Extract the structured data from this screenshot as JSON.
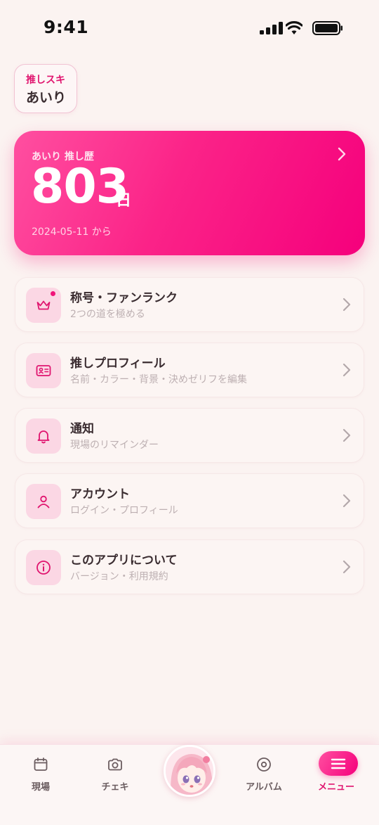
{
  "status_bar": {
    "time": "9:41"
  },
  "oshi_selector": {
    "label": "推しスキ",
    "name": "あいり"
  },
  "hero": {
    "label": "あいり 推し歴",
    "days": "803",
    "unit": "日",
    "since": "2024-05-11 から",
    "accent_start": "#ff4fa0",
    "accent_end": "#f5007c"
  },
  "menu": {
    "items": [
      {
        "title": "称号・ファンランク",
        "subtitle": "2つの道を極める",
        "icon": "crown-icon",
        "has_badge": true
      },
      {
        "title": "推しプロフィール",
        "subtitle": "名前・カラー・背景・決めゼリフを編集",
        "icon": "id-card-icon"
      },
      {
        "title": "通知",
        "subtitle": "現場のリマインダー",
        "icon": "bell-icon"
      },
      {
        "title": "アカウント",
        "subtitle": "ログイン・プロフィール",
        "icon": "person-icon"
      },
      {
        "title": "このアプリについて",
        "subtitle": "バージョン・利用規約",
        "icon": "info-icon"
      }
    ]
  },
  "tab_bar": {
    "tabs": [
      {
        "label": "現場",
        "icon": "calendar-icon"
      },
      {
        "label": "チェキ",
        "icon": "camera-icon"
      },
      {
        "label": "",
        "icon": "avatar"
      },
      {
        "label": "アルバム",
        "icon": "disc-icon"
      },
      {
        "label": "メニュー",
        "icon": "menu-icon",
        "active": true
      }
    ],
    "active_color": "#e0156f"
  }
}
